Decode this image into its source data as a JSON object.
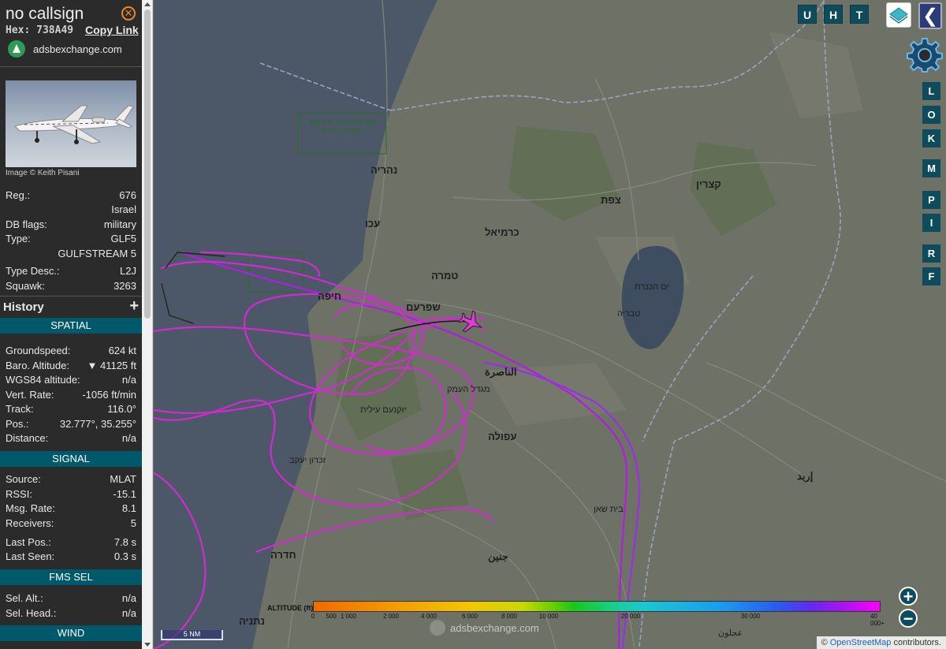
{
  "aircraft": {
    "callsign": "no callsign",
    "hex_label": "Hex:",
    "hex": "738A49",
    "copy_link": "Copy Link",
    "site": "adsbexchange.com",
    "photo_credit": "Image © Keith Pisani",
    "registration_label": "Reg.:",
    "registration": "676",
    "country": "Israel",
    "db_flags_label": "DB flags:",
    "db_flags": "military",
    "type_label": "Type:",
    "type": "GLF5",
    "type_full": "GULFSTREAM 5",
    "type_desc_label": "Type Desc.:",
    "type_desc": "L2J",
    "squawk_label": "Squawk:",
    "squawk": "3263"
  },
  "history": {
    "title": "History",
    "expand": "+"
  },
  "spatial": {
    "title": "SPATIAL",
    "rows": [
      {
        "label": "Groundspeed:",
        "value": "624 kt"
      },
      {
        "label": "Baro. Altitude:",
        "value": "▼ 41125 ft"
      },
      {
        "label": "WGS84 altitude:",
        "value": "n/a"
      },
      {
        "label": "Vert. Rate:",
        "value": "-1056 ft/min"
      },
      {
        "label": "Track:",
        "value": "116.0°"
      },
      {
        "label": "Pos.:",
        "value": "32.777°, 35.255°"
      },
      {
        "label": "Distance:",
        "value": "n/a"
      }
    ]
  },
  "signal": {
    "title": "SIGNAL",
    "rows": [
      {
        "label": "Source:",
        "value": "MLAT"
      },
      {
        "label": "RSSI:",
        "value": "-15.1"
      },
      {
        "label": "Msg. Rate:",
        "value": "8.1"
      },
      {
        "label": "Receivers:",
        "value": "5"
      },
      {
        "label": "Last Pos.:",
        "value": "7.8 s"
      },
      {
        "label": "Last Seen:",
        "value": "0.3 s"
      }
    ]
  },
  "fms": {
    "title": "FMS SEL",
    "rows": [
      {
        "label": "Sel. Alt.:",
        "value": "n/a"
      },
      {
        "label": "Sel. Head.:",
        "value": "n/a"
      }
    ]
  },
  "wind": {
    "title": "WIND"
  },
  "map": {
    "top_buttons": [
      "U",
      "H",
      "T"
    ],
    "side_buttons": [
      "L",
      "O",
      "K",
      "M",
      "P",
      "I",
      "R",
      "F"
    ],
    "collapse": "❮",
    "zoom_in": "+",
    "zoom_out": "−",
    "altitude_title": "ALTITUDE (ft)",
    "altitude_ticks": [
      "0",
      "500",
      "1 000",
      "2 000",
      "4 000",
      "6 000",
      "8 000",
      "10 000",
      "20 000",
      "30 000",
      "40 000+"
    ],
    "scale": "5 NM",
    "watermark": "adsbexchange.com",
    "attribution_prefix": "© ",
    "attribution_link": "OpenStreetMap",
    "attribution_suffix": " contributors.",
    "labels": {
      "haifa": "חיפה",
      "nahariya": "נהריה",
      "akko": "עכו",
      "karmiel": "כרמיאל",
      "tamra": "טמרה",
      "shefaram": "שפרעם",
      "nazareth": "الناصرة",
      "afula": "עפולה",
      "migdal_haemek": "מגדל העמק",
      "yokneam": "יוקנעם עילית",
      "safed": "צפת",
      "tiberias": "טבריה",
      "sea_of_galilee": "ים הכנרת",
      "hadera": "חדרה",
      "netanya": "נתניה",
      "jenin": "جنين",
      "beit_shean": "בית שאן",
      "irbid": "إربد",
      "qatzrin": "קצרין",
      "zichron": "זכרון יעקב",
      "ajloun": "عجلون",
      "nature_reserve": "שמורת טבע ים ראש הנקרה-אכזיב"
    }
  }
}
